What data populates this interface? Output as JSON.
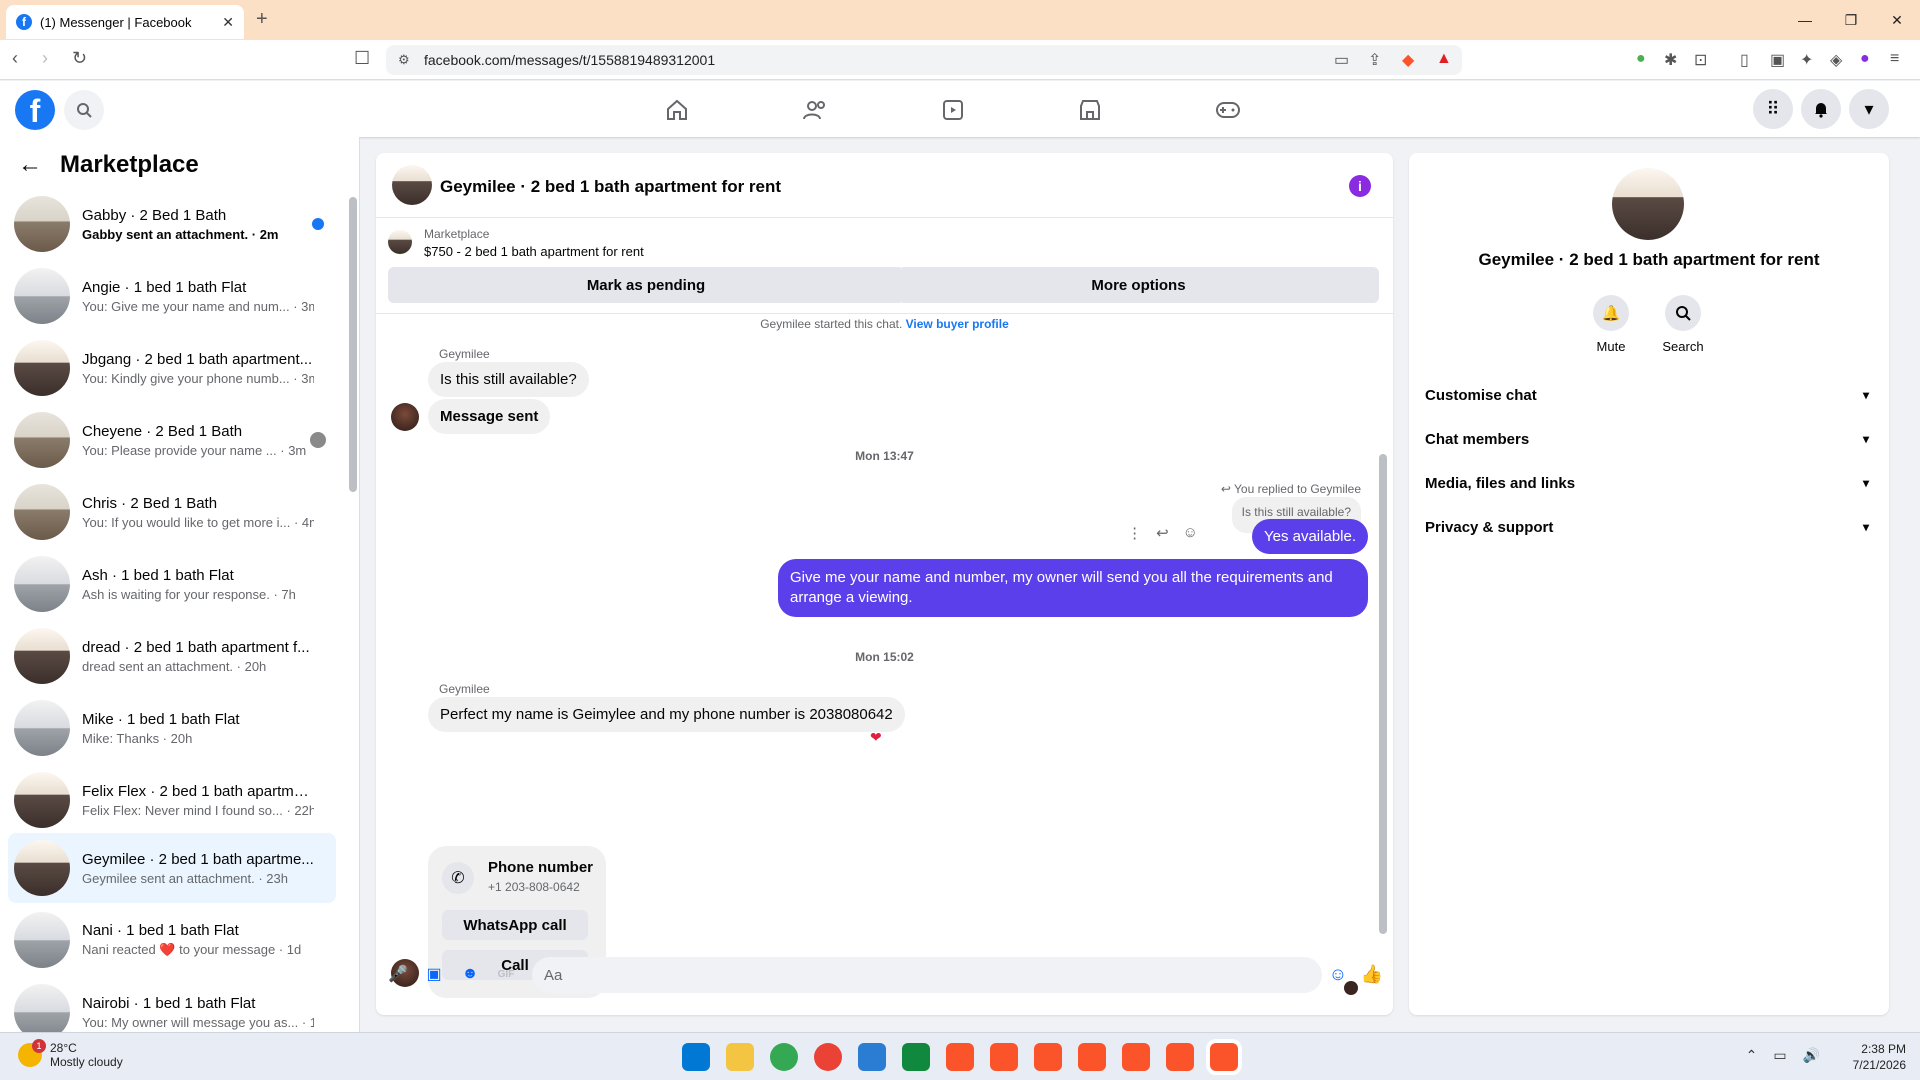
{
  "browser": {
    "tab_title": "(1) Messenger | Facebook",
    "url": "facebook.com/messages/t/1558819489312001"
  },
  "sidebar": {
    "title": "Marketplace",
    "conversations": [
      {
        "name": "Gabby · 2 Bed 1 Bath",
        "preview": "Gabby sent an attachment. · 2m",
        "unread": true
      },
      {
        "name": "Angie · 1 bed 1 bath Flat",
        "preview": "You: Give me your name and num... · 3m"
      },
      {
        "name": "Jbgang · 2 bed 1 bath apartment...",
        "preview": "You: Kindly give your phone numb... · 3m"
      },
      {
        "name": "Cheyene · 2 Bed 1 Bath",
        "preview": "You: Please provide your name ... · 3m"
      },
      {
        "name": "Chris · 2 Bed 1 Bath",
        "preview": "You: If you would like to get more i... · 4m"
      },
      {
        "name": "Ash · 1 bed 1 bath Flat",
        "preview": "Ash is waiting for your response. · 7h"
      },
      {
        "name": "dread · 2 bed 1 bath apartment f...",
        "preview": "dread sent an attachment. · 20h"
      },
      {
        "name": "Mike · 1 bed 1 bath Flat",
        "preview": "Mike: Thanks · 20h"
      },
      {
        "name": "Felix Flex · 2 bed 1 bath apartme...",
        "preview": "Felix Flex: Never mind I found so... · 22h"
      },
      {
        "name": "Geymilee · 2 bed 1 bath apartme...",
        "preview": "Geymilee sent an attachment. · 23h",
        "active": true
      },
      {
        "name": "Nani · 1 bed 1 bath Flat",
        "preview": "Nani reacted ❤️ to your message · 1d"
      },
      {
        "name": "Nairobi · 1 bed 1 bath Flat",
        "preview": "You: My owner will message you as... · 1d"
      }
    ]
  },
  "chat": {
    "title": "Geymilee · 2 bed 1 bath apartment for rent",
    "listing_source": "Marketplace",
    "listing_title": "$750 - 2 bed 1 bath apartment for rent",
    "mark_pending": "Mark as pending",
    "more_options": "More options",
    "started_note": "Geymilee started this chat.",
    "view_buyer": "View buyer profile",
    "sender": "Geymilee",
    "msg1": "Is this still available?",
    "msg2": "Message sent",
    "time1": "Mon 13:47",
    "replied_note": "You replied to Geymilee",
    "quoted": "Is this still available?",
    "out1": "Yes available.",
    "out2": "Give me your name and number, my owner will send you all the requirements and arrange a viewing.",
    "time2": "Mon 15:02",
    "msg3": "Perfect my name is Geimylee and my phone number is 2038080642",
    "card_title": "Phone number",
    "card_number": "+1 203-808-0642",
    "whatsapp": "WhatsApp call",
    "call": "Call",
    "composer_placeholder": "Aa"
  },
  "right_panel": {
    "name": "Geymilee · 2 bed 1 bath apartment for rent",
    "mute": "Mute",
    "search": "Search",
    "rows": [
      "Customise chat",
      "Chat members",
      "Media, files and links",
      "Privacy & support"
    ]
  },
  "taskbar": {
    "temp": "28°C",
    "weather": "Mostly cloudy",
    "weather_badge": "1",
    "time": "2:38 PM",
    "date": "7/21/2026"
  },
  "colors": {
    "brand": "#1877f2",
    "outgoing": "#5b3fea",
    "accent": "#0866ff"
  }
}
